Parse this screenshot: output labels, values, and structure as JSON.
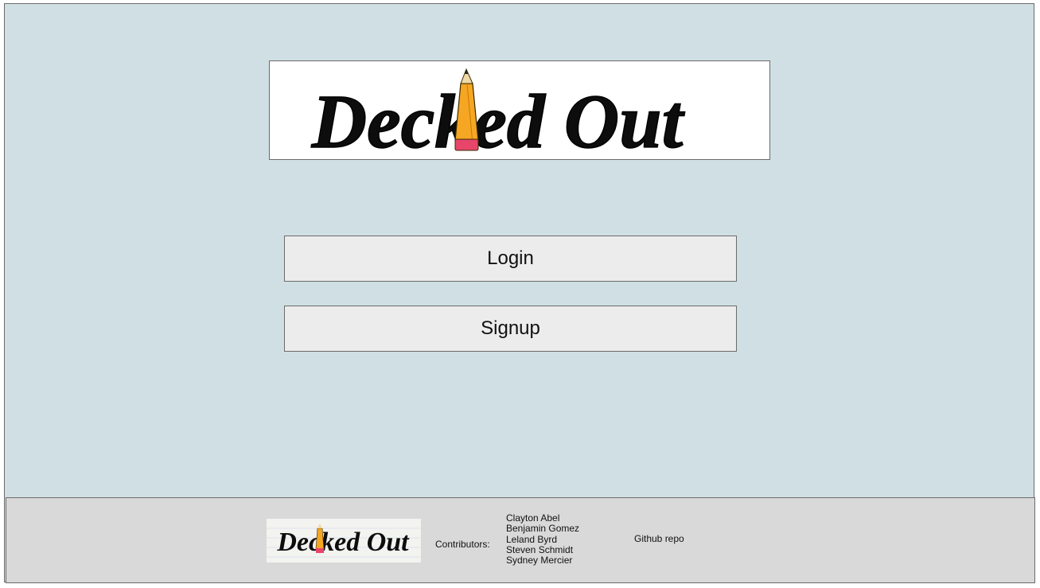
{
  "brand": {
    "name": "Decked Out"
  },
  "auth": {
    "login_label": "Login",
    "signup_label": "Signup"
  },
  "footer": {
    "contributors_label": "Contributors:",
    "contributors": [
      "Clayton Abel",
      "Benjamin Gomez",
      "Leland Byrd",
      "Steven Schmidt",
      "Sydney Mercier"
    ],
    "github_label": "Github repo"
  },
  "colors": {
    "page_bg": "#d0dfe3",
    "footer_bg": "#d9d9d9",
    "button_bg": "#ececec",
    "pencil_body": "#f5a623",
    "pencil_eraser": "#e8456b"
  },
  "icons": {
    "logo_mark": "pencil-icon"
  }
}
